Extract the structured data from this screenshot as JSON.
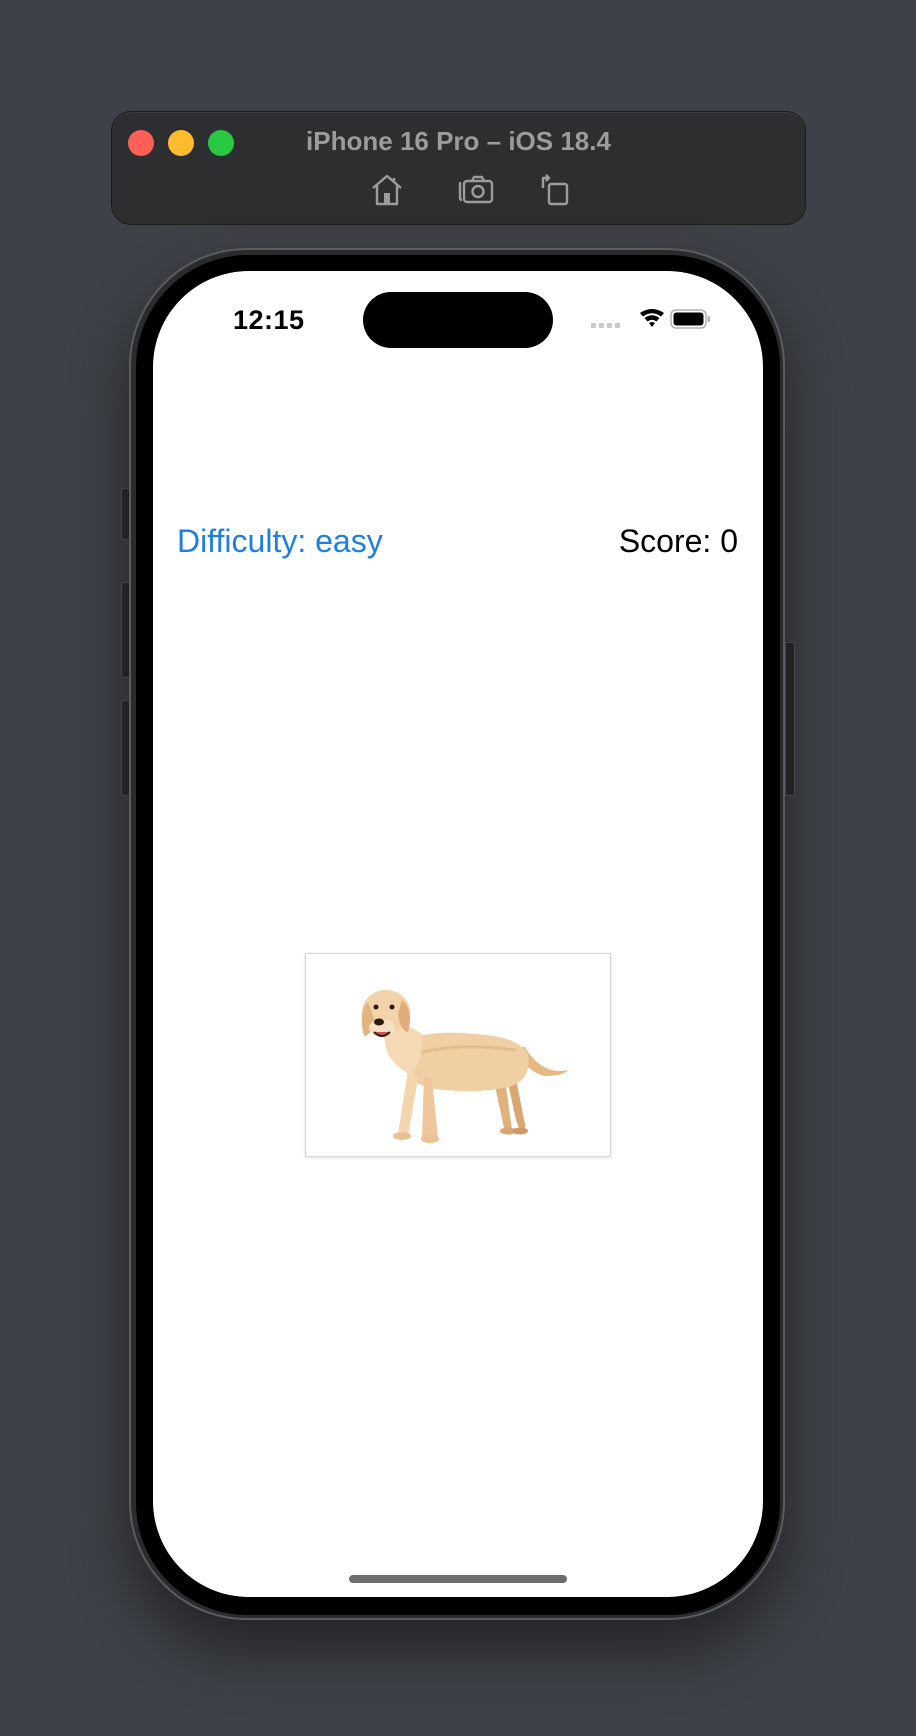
{
  "simulator": {
    "title": "iPhone 16 Pro – iOS 18.4",
    "toolbar_icons": [
      "home-icon",
      "screenshot-icon",
      "rotate-icon"
    ],
    "traffic_lights": {
      "close": "#ff5f57",
      "minimize": "#febc2e",
      "zoom": "#28c840"
    }
  },
  "status_bar": {
    "time": "12:15",
    "icons": [
      "cellular-signal-icon",
      "wifi-icon",
      "battery-icon"
    ]
  },
  "game": {
    "difficulty_label": "Difficulty: easy",
    "score_label": "Score: 0",
    "image_subject": "dog",
    "accent_color": "#1f7fe0"
  }
}
